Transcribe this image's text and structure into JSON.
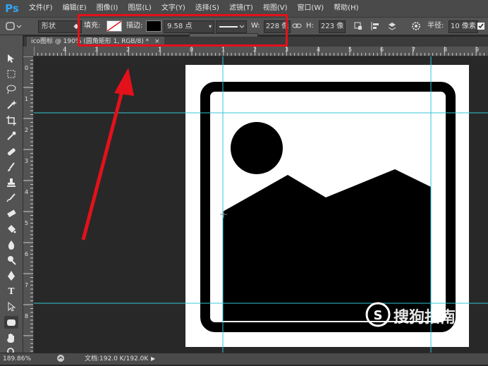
{
  "app": {
    "logo": "Ps"
  },
  "menus": [
    "文件(F)",
    "编辑(E)",
    "图像(I)",
    "图层(L)",
    "文字(Y)",
    "选择(S)",
    "滤镜(T)",
    "视图(V)",
    "窗口(W)",
    "帮助(H)"
  ],
  "options": {
    "mode": "形状",
    "fill_label": "填充:",
    "stroke_label": "描边:",
    "stroke_width": "9.58 点",
    "w_label": "W:",
    "w_value": "228 像",
    "h_label": "H:",
    "h_value": "223 像",
    "radius_label": "半径:",
    "radius_value": "10 像素",
    "align_edges": "对"
  },
  "document_tab": {
    "title": "ico图标 @ 190% (圆角矩形 1, RGB/8) *",
    "close": "×"
  },
  "rulers": {
    "h_ticks": [
      "4",
      "3",
      "2",
      "1",
      "0",
      "1",
      "2",
      "3",
      "4",
      "5",
      "6",
      "7",
      "8",
      "9"
    ],
    "v_ticks": [
      "0",
      "1",
      "2",
      "3",
      "4",
      "5",
      "6",
      "7",
      "8"
    ]
  },
  "status": {
    "zoom": "189.86%",
    "doc": "文档:192.0 K/192.0K"
  },
  "watermark": {
    "brand": "搜狗指南",
    "url": "zhinan.sogou.com"
  },
  "colors": {
    "highlight": "#e3111a",
    "guide": "#35c7d6",
    "accent": "#34a4f2"
  },
  "icons": [
    "move-icon",
    "marquee-icon",
    "lasso-icon",
    "magic-wand-icon",
    "crop-icon",
    "eyedropper-icon",
    "healing-icon",
    "brush-icon",
    "stamp-icon",
    "history-brush-icon",
    "eraser-icon",
    "bucket-icon",
    "blur-icon",
    "dodge-icon",
    "pen-icon",
    "type-icon",
    "path-select-icon",
    "rounded-rect-icon",
    "hand-icon",
    "zoom-icon"
  ]
}
